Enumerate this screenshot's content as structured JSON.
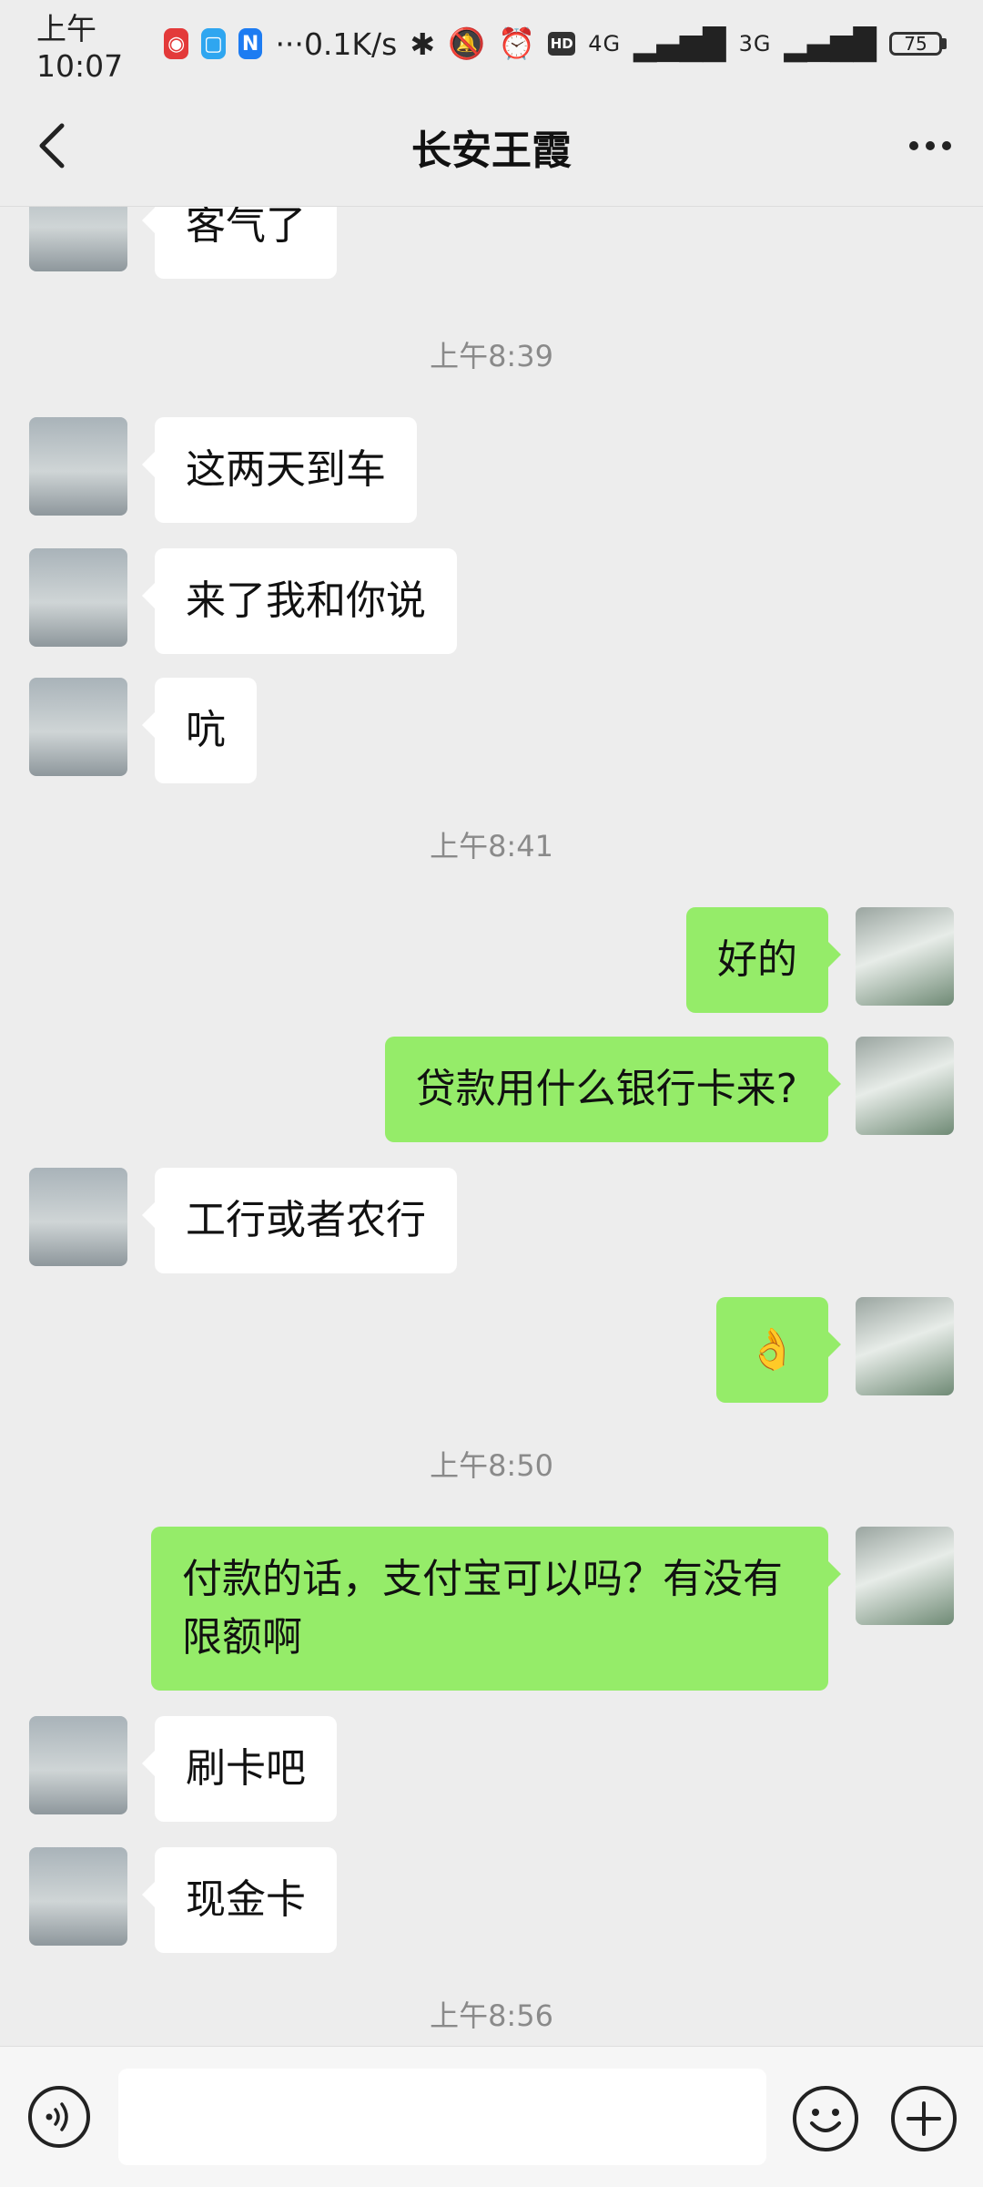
{
  "status_bar": {
    "time": "上午10:07",
    "more": "···",
    "net_speed": "0.1K/s",
    "signal_1": "4G",
    "signal_2": "3G",
    "battery": "75"
  },
  "header": {
    "title": "长安王霞"
  },
  "messages": [
    {
      "side": "in",
      "text": "客气了"
    },
    {
      "type": "time",
      "text": "上午8:39"
    },
    {
      "side": "in",
      "text": "这两天到车"
    },
    {
      "side": "in",
      "text": "来了我和你说"
    },
    {
      "side": "in",
      "text": "吭"
    },
    {
      "type": "time",
      "text": "上午8:41"
    },
    {
      "side": "out",
      "text": "好的"
    },
    {
      "side": "out",
      "text": "贷款用什么银行卡来?"
    },
    {
      "side": "in",
      "text": "工行或者农行"
    },
    {
      "side": "out",
      "text": "👌"
    },
    {
      "type": "time",
      "text": "上午8:50"
    },
    {
      "side": "out",
      "text": "付款的话，支付宝可以吗？有没有限额啊"
    },
    {
      "side": "in",
      "text": "刷卡吧"
    },
    {
      "side": "in",
      "text": "现金卡"
    },
    {
      "type": "time",
      "text": "上午8:56"
    }
  ],
  "input": {
    "placeholder": ""
  },
  "colors": {
    "background": "#ededed",
    "outgoing_bubble": "#95ec69",
    "incoming_bubble": "#ffffff"
  }
}
